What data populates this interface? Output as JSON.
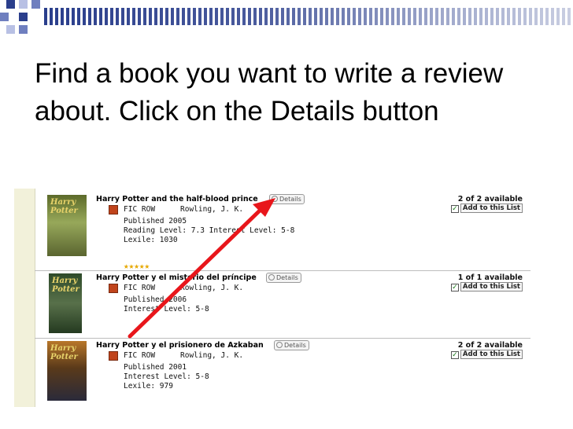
{
  "slide": {
    "title": "Find a book you want to write a review about. Click on the Details button"
  },
  "colors": {
    "header_band": "#2a3e8c",
    "header_squares": [
      "#2a3e8c",
      "#6f7fbf",
      "#b8c0e4"
    ],
    "arrow": "#e8161b",
    "panel_sidebar": "#f2f1da",
    "book_icon": "#c0441c",
    "stars": "#e6a800"
  },
  "results": [
    {
      "title": "Harry Potter and the half-blood prince",
      "details_label": "Details",
      "call_number": "FIC ROW",
      "author": "Rowling, J. K.",
      "lines": [
        "Published 2005",
        "Reading Level: 7.3  Interest Level: 5-8",
        "Lexile: 1030"
      ],
      "rating_stars": "★★★★★",
      "availability": "2 of 2 available",
      "add_list_label": "Add to this List",
      "cover_label": "Harry Potter",
      "cover_color": "#7b8a3a"
    },
    {
      "title": "Harry Potter y el misterio del príncipe",
      "details_label": "Details",
      "call_number": "FIC ROW",
      "author": "Rowling, J. K.",
      "lines": [
        "Published 2006",
        "Interest Level: 5-8"
      ],
      "availability": "1 of 1 available",
      "add_list_label": "Add to this List",
      "cover_label": "Harry Potter",
      "cover_color": "#3f5a3a"
    },
    {
      "title": "Harry Potter y el prisionero de Azkaban",
      "details_label": "Details",
      "call_number": "FIC ROW",
      "author": "Rowling, J. K.",
      "lines": [
        "Published 2001",
        "Interest Level: 5-8",
        "Lexile: 979"
      ],
      "availability": "2 of 2 available",
      "add_list_label": "Add to this List",
      "cover_label": "Harry Potter",
      "cover_color": "#6b4a2a"
    }
  ]
}
